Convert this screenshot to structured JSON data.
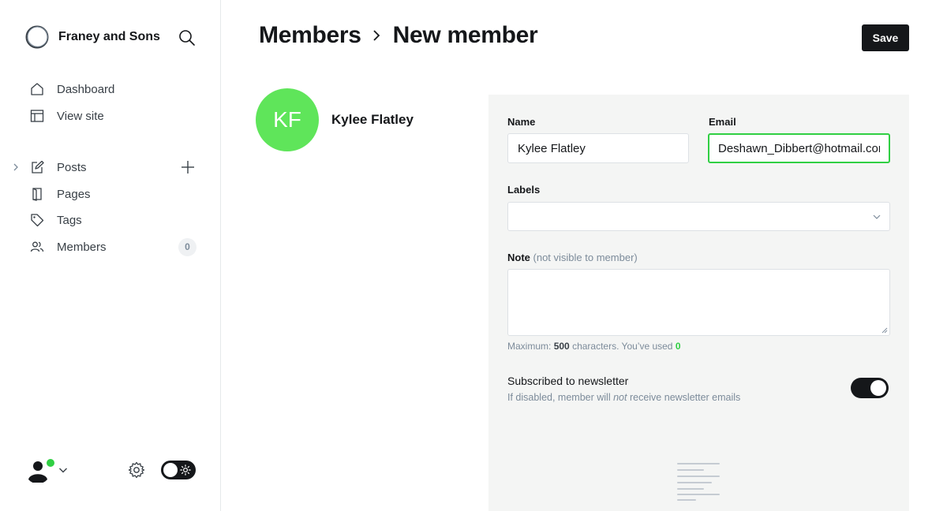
{
  "sidebar": {
    "brand_name": "Franey and Sons",
    "nav_primary": [
      {
        "label": "Dashboard",
        "icon": "home-icon"
      },
      {
        "label": "View site",
        "icon": "layout-icon"
      }
    ],
    "nav_content": [
      {
        "label": "Posts",
        "icon": "edit-icon"
      },
      {
        "label": "Pages",
        "icon": "page-icon"
      },
      {
        "label": "Tags",
        "icon": "tag-icon"
      },
      {
        "label": "Members",
        "icon": "members-icon",
        "count": "0"
      }
    ]
  },
  "header": {
    "breadcrumb_parent": "Members",
    "breadcrumb_current": "New member",
    "save_label": "Save"
  },
  "member": {
    "initials": "KF",
    "name": "Kylee Flatley",
    "avatar_color": "#5fe55a"
  },
  "form": {
    "name_label": "Name",
    "name_value": "Kylee Flatley",
    "email_label": "Email",
    "email_value": "Deshawn_Dibbert@hotmail.com",
    "labels_label": "Labels",
    "labels_value": "",
    "note_label": "Note",
    "note_sublabel": "(not visible to member)",
    "note_value": "",
    "hint_prefix": "Maximum:",
    "hint_max": "500",
    "hint_middle": "characters. You’ve used",
    "hint_used": "0",
    "newsletter_title": "Subscribed to newsletter",
    "newsletter_desc_1": "If disabled, member will",
    "newsletter_desc_em": "not",
    "newsletter_desc_2": "receive newsletter emails",
    "newsletter_enabled": true
  },
  "colors": {
    "accent_green": "#30cf43",
    "dark": "#15171a",
    "panel_bg": "#f4f5f4"
  }
}
